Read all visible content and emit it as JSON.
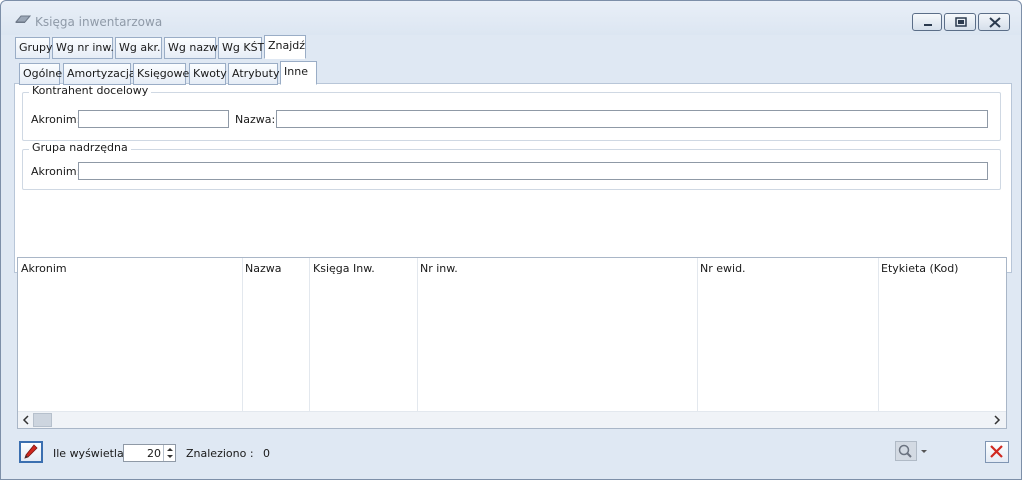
{
  "window": {
    "title": "Księga inwentarzowa"
  },
  "tabs_top": [
    {
      "label": "Grupy"
    },
    {
      "label": "Wg nr inw."
    },
    {
      "label": "Wg akr."
    },
    {
      "label": "Wg nazw"
    },
    {
      "label": "Wg KŚT"
    },
    {
      "label": "Znajdź"
    }
  ],
  "tabs_sub": [
    {
      "label": "Ogólne"
    },
    {
      "label": "Amortyzacja"
    },
    {
      "label": "Księgowe"
    },
    {
      "label": "Kwoty"
    },
    {
      "label": "Atrybuty"
    },
    {
      "label": "Inne"
    }
  ],
  "kontrahent": {
    "group_title": "Kontrahent docelowy",
    "akronim_label": "Akronim:",
    "akronim_value": "",
    "nazwa_label": "Nazwa:",
    "nazwa_value": ""
  },
  "grupa": {
    "group_title": "Grupa nadrzędna",
    "akronim_label": "Akronim:",
    "akronim_value": ""
  },
  "grid": {
    "columns": [
      "Akronim",
      "Nazwa",
      "Księga Inw.",
      "Nr inw.",
      "Nr ewid.",
      "Etykieta (Kod)"
    ],
    "rows": []
  },
  "footer": {
    "ile_label": "Ile wyświetlać:",
    "ile_value": "20",
    "znaleziono_label": "Znaleziono :",
    "znaleziono_value": "0"
  },
  "icons": {
    "title": "book-icon",
    "edit": "pencil-icon",
    "search": "magnifier-icon",
    "close": "red-x-icon"
  },
  "colors": {
    "window_bg": "#dfe8f3",
    "accent_blue": "#3b6fb0",
    "close_red": "#d0281f"
  }
}
